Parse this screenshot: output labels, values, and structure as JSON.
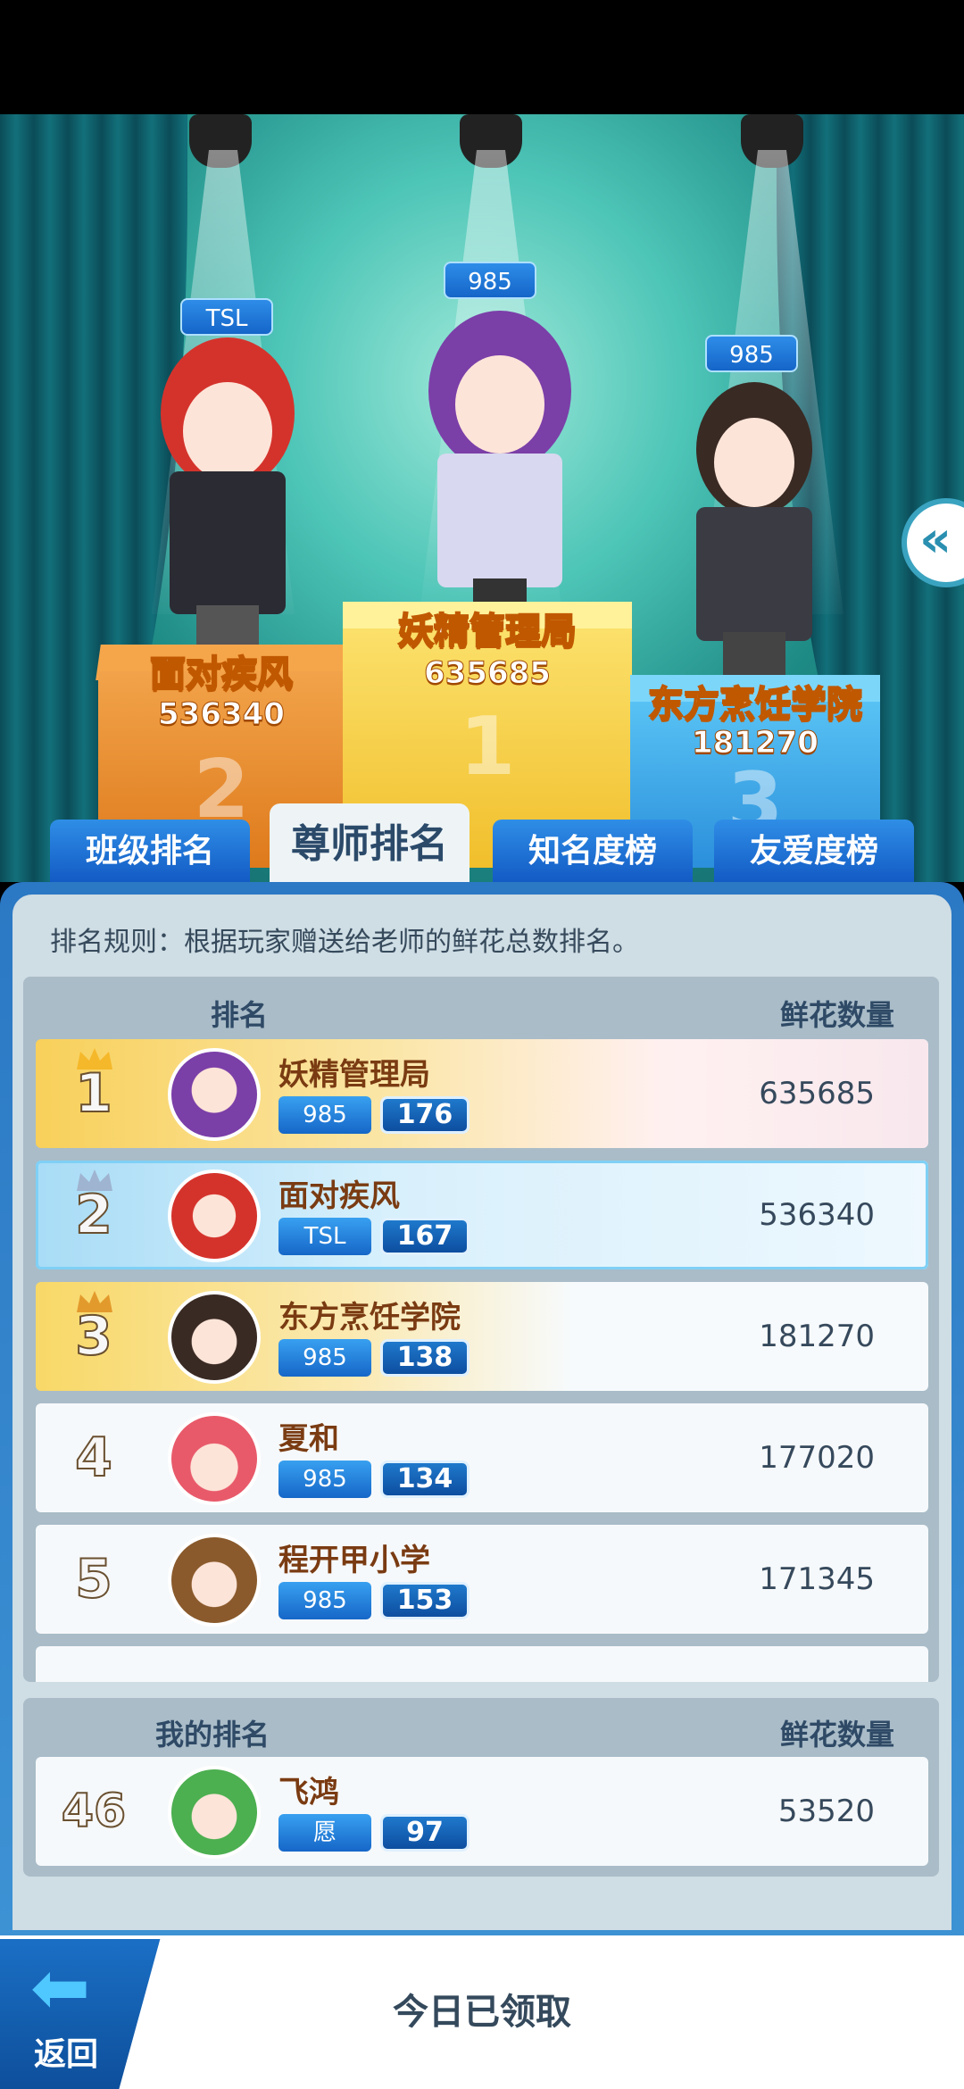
{
  "podium": {
    "first": {
      "name": "妖精管理局",
      "score": "635685",
      "tag": "985",
      "place": "1"
    },
    "second": {
      "name": "面对疾风",
      "score": "536340",
      "tag": "TSL",
      "place": "2"
    },
    "third": {
      "name": "东方烹饪学院",
      "score": "181270",
      "tag": "985",
      "place": "3"
    },
    "side_button": "«"
  },
  "tabs": [
    "班级排名",
    "尊师排名",
    "知名度榜",
    "友爱度榜"
  ],
  "active_tab": "尊师排名",
  "rule_text": "排名规则：根据玩家赠送给老师的鲜花总数排名。",
  "list": {
    "header_rank": "排名",
    "header_count": "鲜花数量",
    "rows": [
      {
        "rank": "1",
        "name": "妖精管理局",
        "tag": "985",
        "level": "176",
        "flowers": "635685"
      },
      {
        "rank": "2",
        "name": "面对疾风",
        "tag": "TSL",
        "level": "167",
        "flowers": "536340"
      },
      {
        "rank": "3",
        "name": "东方烹饪学院",
        "tag": "985",
        "level": "138",
        "flowers": "181270"
      },
      {
        "rank": "4",
        "name": "夏和",
        "tag": "985",
        "level": "134",
        "flowers": "177020"
      },
      {
        "rank": "5",
        "name": "程开甲小学",
        "tag": "985",
        "level": "153",
        "flowers": "171345"
      }
    ]
  },
  "my_rank": {
    "header_rank": "我的排名",
    "header_count": "鲜花数量",
    "rank": "46",
    "name": "飞鸿",
    "tag": "愿",
    "level": "97",
    "flowers": "53520"
  },
  "bottom": {
    "claimed": "今日已领取",
    "back": "返回"
  },
  "colors": {
    "tab_blue": "#1f72d4",
    "name_brown": "#7a3b12",
    "gold": "#f8d05a"
  }
}
